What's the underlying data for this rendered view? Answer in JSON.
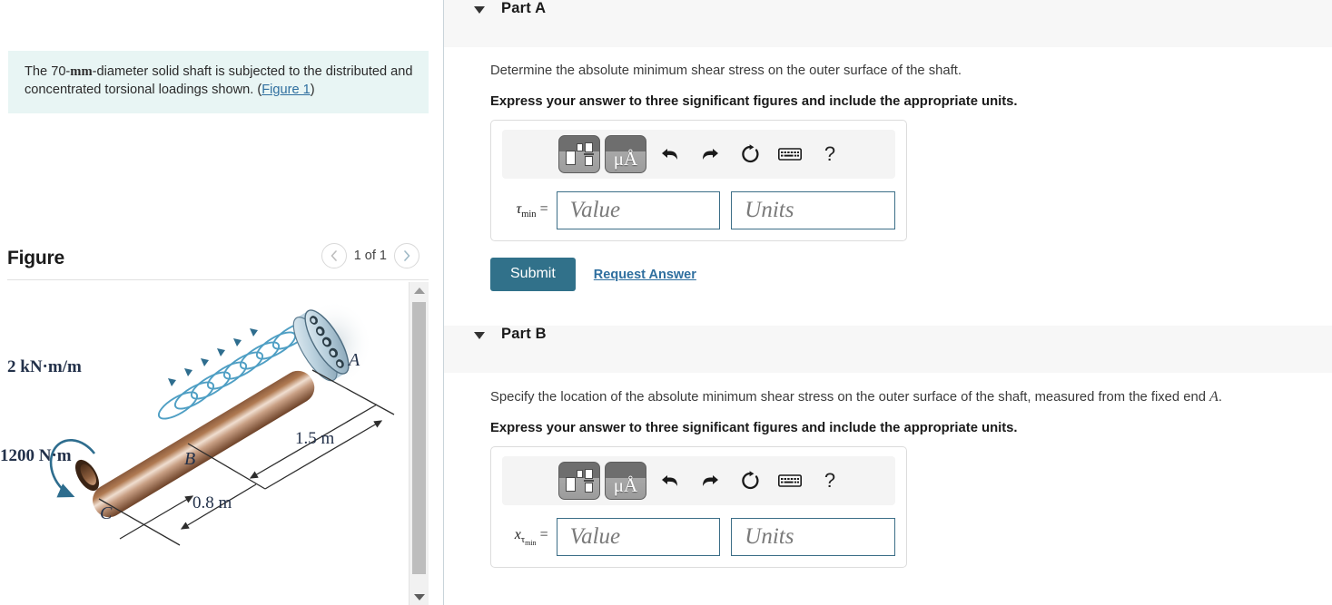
{
  "left": {
    "problem_text_1": "The 70-",
    "problem_unit": "mm",
    "problem_text_2": "-diameter solid shaft is subjected to the distributed and concentrated torsional loadings shown. (",
    "figure_link": "Figure 1",
    "problem_text_3": ")",
    "figure_title": "Figure",
    "figure_count": "1 of 1",
    "prev_icon": "chevron-left-icon",
    "next_icon": "chevron-right-icon"
  },
  "figure": {
    "label_distributed_torque": "2 kN·m/m",
    "label_concentrated_torque": "1200 N·m",
    "label_point_a": "A",
    "label_point_b": "B",
    "label_point_c": "C",
    "label_dim_long": "1.5 m",
    "label_dim_short": "0.8 m"
  },
  "parts": [
    {
      "id": "part-a",
      "title": "Part A",
      "question": "Determine the absolute minimum shear stress on the outer surface of the shaft.",
      "instruction": "Express your answer to three significant figures and include the appropriate units.",
      "symbol_main": "τ",
      "symbol_sub": "min",
      "symbol_sub2": "",
      "equals": "=",
      "value_placeholder": "Value",
      "units_placeholder": "Units",
      "value_current": "",
      "units_current": "",
      "submit_label": "Submit",
      "request_label": "Request Answer",
      "has_actions": true
    },
    {
      "id": "part-b",
      "title": "Part B",
      "question_1": "Specify the location of the absolute minimum shear stress on the outer surface of the shaft, measured from the fixed end",
      "question_italic": "A",
      "question_2": ".",
      "instruction": "Express your answer to three significant figures and include the appropriate units.",
      "symbol_main": "x",
      "symbol_sub": "τ",
      "symbol_sub2": "min",
      "equals": "=",
      "value_placeholder": "Value",
      "units_placeholder": "Units",
      "value_current": "",
      "units_current": "",
      "has_actions": false
    }
  ],
  "toolbar": {
    "template_icon": "math-template-icon",
    "units_icon": "micro-angstrom-units-icon",
    "units_glyph": "μÅ",
    "undo_icon": "undo-arrow-icon",
    "redo_icon": "redo-arrow-icon",
    "reset_icon": "reset-circle-icon",
    "keyboard_icon": "keyboard-icon",
    "help_icon": "question-mark-icon",
    "help_glyph": "?"
  },
  "colors": {
    "accent_teal": "#31718a",
    "link_blue": "#2f6f9f",
    "problem_bg": "#e8f5f4",
    "header_bg": "#f7f7f7",
    "field_border": "#3c6e87"
  }
}
